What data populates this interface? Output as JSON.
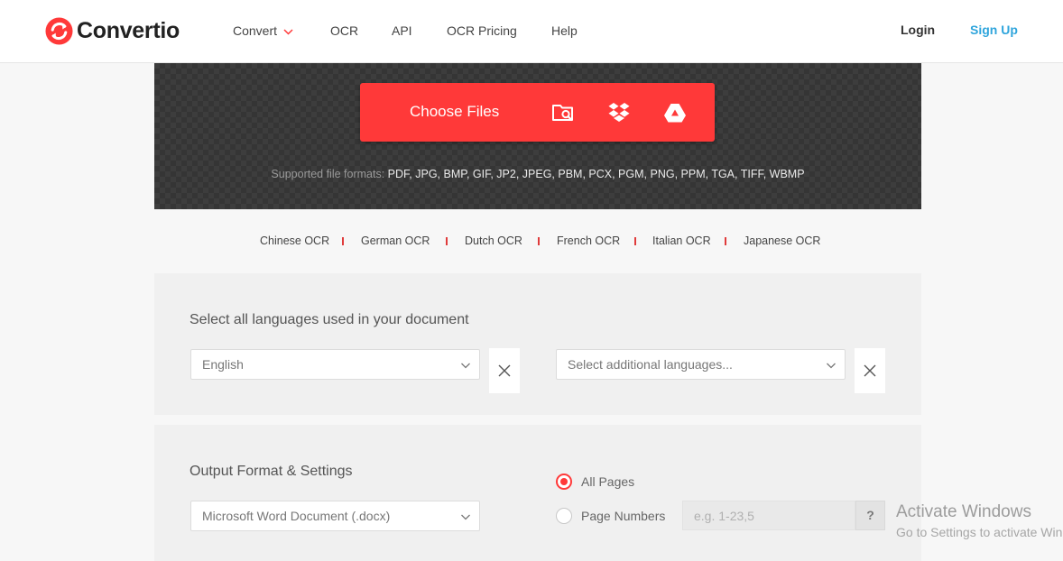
{
  "brand": {
    "name": "Convertio",
    "accent_color": "#ff3939",
    "link_color": "#2fa5dc"
  },
  "nav": {
    "items": [
      {
        "label": "Convert",
        "has_dropdown": true
      },
      {
        "label": "OCR"
      },
      {
        "label": "API"
      },
      {
        "label": "OCR Pricing"
      },
      {
        "label": "Help"
      }
    ],
    "login": "Login",
    "signup": "Sign Up"
  },
  "upload": {
    "button_label": "Choose Files",
    "sources": [
      "folder-search-icon",
      "dropbox-icon",
      "google-drive-icon"
    ],
    "formats_prefix": "Supported file formats:",
    "formats_list": "PDF, JPG, BMP, GIF, JP2, JPEG, PBM, PCX, PGM, PNG, PPM, TGA, TIFF, WBMP"
  },
  "ocr_languages": [
    "Chinese OCR",
    "German OCR",
    "Dutch OCR",
    "French OCR",
    "Italian OCR",
    "Japanese OCR"
  ],
  "language_panel": {
    "title": "Select all languages used in your document",
    "primary_value": "English",
    "additional_placeholder": "Select additional languages..."
  },
  "output_panel": {
    "title": "Output Format & Settings",
    "format_value": "Microsoft Word Document (.docx)",
    "pages_options": [
      {
        "label": "All Pages",
        "selected": true
      },
      {
        "label": "Page Numbers",
        "selected": false
      }
    ],
    "page_numbers_placeholder": "e.g. 1-23,5",
    "help_label": "?"
  },
  "watermark": {
    "line1": "Activate Windows",
    "line2": "Go to Settings to activate Windows."
  }
}
